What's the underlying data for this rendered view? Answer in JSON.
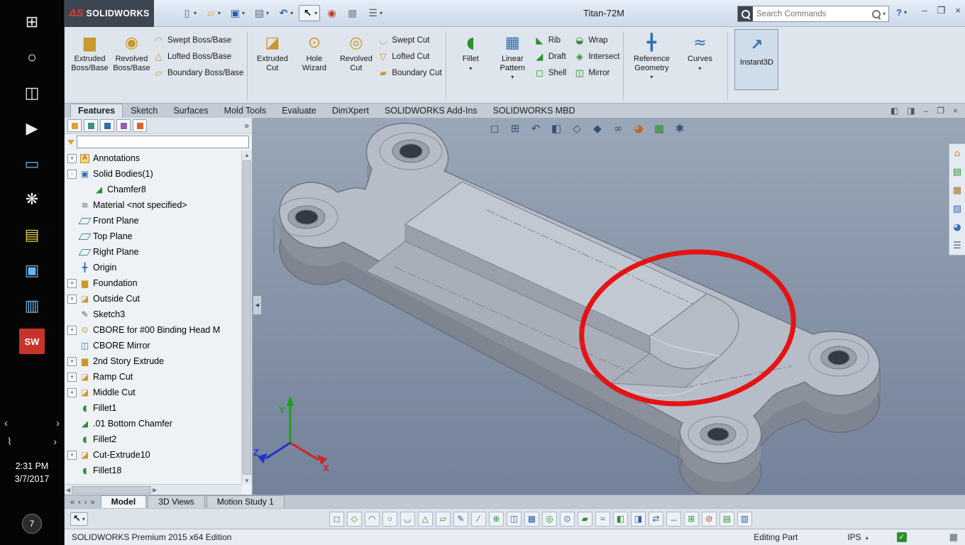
{
  "taskbar": {
    "apps": [
      {
        "name": "start",
        "g": "⊞",
        "c": "w"
      },
      {
        "name": "cortana",
        "g": "○",
        "c": "w"
      },
      {
        "name": "task-view",
        "g": "◫",
        "c": "w"
      },
      {
        "name": "movies-tv",
        "g": "▶",
        "c": "w"
      },
      {
        "name": "tablet-app",
        "g": "▭",
        "c": "b"
      },
      {
        "name": "settings",
        "g": "❋",
        "c": "w"
      },
      {
        "name": "sticky-notes",
        "g": "▤",
        "c": "y"
      },
      {
        "name": "photos",
        "g": "▣",
        "c": "b"
      },
      {
        "name": "mail",
        "g": "▥",
        "c": "b"
      },
      {
        "name": "solidworks-2015",
        "g": "SW",
        "c": "sw"
      }
    ],
    "scroll_left": "‹",
    "scroll_right": "›",
    "wifi": "⌇",
    "wifi_chevron": "›",
    "time": "2:31 PM",
    "date": "3/7/2017",
    "badge": "7"
  },
  "titlebar": {
    "logo_mark": "ΔS",
    "logo_text": "SOLIDWORKS",
    "doc_title": "Titan-72M",
    "tools": [
      {
        "icon": "new",
        "caret": "▾"
      },
      {
        "icon": "open",
        "caret": "▾"
      },
      {
        "icon": "save",
        "caret": "▾"
      },
      {
        "icon": "print",
        "caret": "▾"
      },
      {
        "icon": "undo",
        "caret": "▾"
      },
      {
        "icon": "select",
        "caret": "▾",
        "active": true
      },
      {
        "icon": "rebuild"
      },
      {
        "icon": "file-properties"
      },
      {
        "icon": "options",
        "caret": "▾"
      }
    ],
    "search_placeholder": "Search Commands",
    "search_caret": "▾",
    "help": "?",
    "help_caret": "▾",
    "win_min": "–",
    "win_max": "❐",
    "win_close": "×"
  },
  "ribbon": {
    "tabs": [
      {
        "label": "Features",
        "active": true
      },
      {
        "label": "Sketch"
      },
      {
        "label": "Surfaces"
      },
      {
        "label": "Mold Tools"
      },
      {
        "label": "Evaluate"
      },
      {
        "label": "DimXpert"
      },
      {
        "label": "SOLIDWORKS Add-Ins"
      },
      {
        "label": "SOLIDWORKS MBD"
      }
    ],
    "doc_controls": [
      {
        "g": "◧"
      },
      {
        "g": "◨"
      },
      {
        "g": "–"
      },
      {
        "g": "❐"
      },
      {
        "g": "×"
      }
    ],
    "large1": [
      {
        "label": "Extruded Boss/Base",
        "icon": "extruded-boss"
      },
      {
        "label": "Revolved Boss/Base",
        "icon": "revolved-boss"
      }
    ],
    "stack1": [
      {
        "label": "Swept Boss/Base",
        "icon": "swept-boss"
      },
      {
        "label": "Lofted Boss/Base",
        "icon": "lofted-boss"
      },
      {
        "label": "Boundary Boss/Base",
        "icon": "boundary-boss"
      }
    ],
    "large2": [
      {
        "label": "Extruded Cut",
        "icon": "extruded-cut"
      },
      {
        "label": "Hole Wizard",
        "icon": "hole-wizard"
      },
      {
        "label": "Revolved Cut",
        "icon": "revolved-cut"
      }
    ],
    "stack2": [
      {
        "label": "Swept Cut",
        "icon": "swept-cut"
      },
      {
        "label": "Lofted Cut",
        "icon": "lofted-cut"
      },
      {
        "label": "Boundary Cut",
        "icon": "boundary-cut"
      }
    ],
    "large3": [
      {
        "label": "Fillet",
        "icon": "fillet",
        "caret": "▾"
      },
      {
        "label": "Linear Pattern",
        "icon": "linear-pattern",
        "caret": "▾"
      }
    ],
    "stack3": [
      {
        "label": "Rib",
        "icon": "rib"
      },
      {
        "label": "Draft",
        "icon": "draft"
      },
      {
        "label": "Shell",
        "icon": "shell"
      }
    ],
    "stack4": [
      {
        "label": "Wrap",
        "icon": "wrap"
      },
      {
        "label": "Intersect",
        "icon": "intersect"
      },
      {
        "label": "Mirror",
        "icon": "mirror"
      }
    ],
    "large4": [
      {
        "label": "Reference Geometry",
        "icon": "reference-geometry",
        "caret": "▾"
      },
      {
        "label": "Curves",
        "icon": "curves",
        "caret": "▾"
      }
    ],
    "instant3d": {
      "label": "Instant3D",
      "icon": "instant3d"
    }
  },
  "panel": {
    "tabs": [
      "feature-manager",
      "property-manager",
      "configuration-manager",
      "dimxpert-manager",
      "display-manager"
    ],
    "chevron": "»"
  },
  "tree": {
    "items": [
      {
        "label": "Annotations",
        "icon": "tree-annotations",
        "exp": "+"
      },
      {
        "label": "Solid Bodies(1)",
        "icon": "tree-bodies",
        "exp": "-"
      },
      {
        "label": "Chamfer8",
        "icon": "tree-chamfer",
        "ind": 1
      },
      {
        "label": "Material <not specified>",
        "icon": "tree-material"
      },
      {
        "label": "Front Plane",
        "icon": "tree-plane"
      },
      {
        "label": "Top Plane",
        "icon": "tree-plane"
      },
      {
        "label": "Right Plane",
        "icon": "tree-plane"
      },
      {
        "label": "Origin",
        "icon": "tree-origin"
      },
      {
        "label": "Foundation",
        "icon": "tree-boss",
        "exp": "+"
      },
      {
        "label": "Outside Cut",
        "icon": "tree-cut",
        "exp": "+"
      },
      {
        "label": "Sketch3",
        "icon": "tree-sketch"
      },
      {
        "label": "CBORE for #00 Binding Head M",
        "icon": "tree-hole",
        "exp": "+"
      },
      {
        "label": "CBORE Mirror",
        "icon": "tree-mirror"
      },
      {
        "label": "2nd Story Extrude",
        "icon": "tree-boss",
        "exp": "+"
      },
      {
        "label": "Ramp Cut",
        "icon": "tree-cut",
        "exp": "+"
      },
      {
        "label": "Middle Cut",
        "icon": "tree-cut",
        "exp": "+"
      },
      {
        "label": "Fillet1",
        "icon": "tree-fillet"
      },
      {
        "label": ".01 Bottom Chamfer",
        "icon": "tree-chamfer"
      },
      {
        "label": "Fillet2",
        "icon": "tree-fillet"
      },
      {
        "label": "Cut-Extrude10",
        "icon": "tree-cut",
        "exp": "+"
      },
      {
        "label": "Fillet18",
        "icon": "tree-fillet"
      }
    ]
  },
  "viewport": {
    "hud": [
      "zoom-fit",
      "zoom-area",
      "previous-view",
      "section-view",
      "view-orientation",
      "display-style",
      "hide-show",
      "edit-appearance",
      "scene",
      "view-settings"
    ],
    "taskpane": [
      "home",
      "solidworks-resources",
      "design-library",
      "file-explorer",
      "appearances",
      "custom-properties"
    ],
    "splitter": "◀",
    "triad": {
      "x": "X",
      "y": "Y",
      "z": "Z"
    },
    "annotation_color": "#e51414"
  },
  "doctabs": {
    "nav": [
      "«",
      "‹",
      "›",
      "»"
    ],
    "tabs": [
      {
        "label": "Model",
        "active": true
      },
      {
        "label": "3D Views"
      },
      {
        "label": "Motion Study 1"
      }
    ]
  },
  "macro": {
    "select_caret": "▾",
    "items": [
      {
        "g": "◻",
        "c": "g"
      },
      {
        "g": "◇",
        "c": "g"
      },
      {
        "g": "◠",
        "c": "b"
      },
      {
        "g": "○",
        "c": "g"
      },
      {
        "g": "◡",
        "c": "b"
      },
      {
        "g": "△",
        "c": "g"
      },
      {
        "g": "▱",
        "c": "g"
      },
      {
        "g": "✎",
        "c": "b"
      },
      {
        "g": "∕",
        "c": "b"
      },
      {
        "g": "⊕",
        "c": "g"
      },
      {
        "g": "◫",
        "c": "b"
      },
      {
        "g": "▦",
        "c": "b"
      },
      {
        "g": "◎",
        "c": "g"
      },
      {
        "g": "⊙",
        "c": "b"
      },
      {
        "g": "▰",
        "c": "g"
      },
      {
        "g": "≈",
        "c": "b"
      },
      {
        "g": "◧",
        "c": "g"
      },
      {
        "g": "◨",
        "c": "b"
      },
      {
        "g": "⇄",
        "c": "b"
      },
      {
        "g": "↔",
        "c": "b"
      },
      {
        "g": "⊞",
        "c": "g"
      },
      {
        "g": "⊘",
        "c": "r"
      },
      {
        "g": "▤",
        "c": "g"
      },
      {
        "g": "▥",
        "c": "b"
      }
    ]
  },
  "status": {
    "left": "SOLIDWORKS Premium 2015 x64 Edition",
    "editing": "Editing Part",
    "units": "IPS",
    "units_caret": "▴",
    "check": "✓",
    "tray": "▦"
  }
}
